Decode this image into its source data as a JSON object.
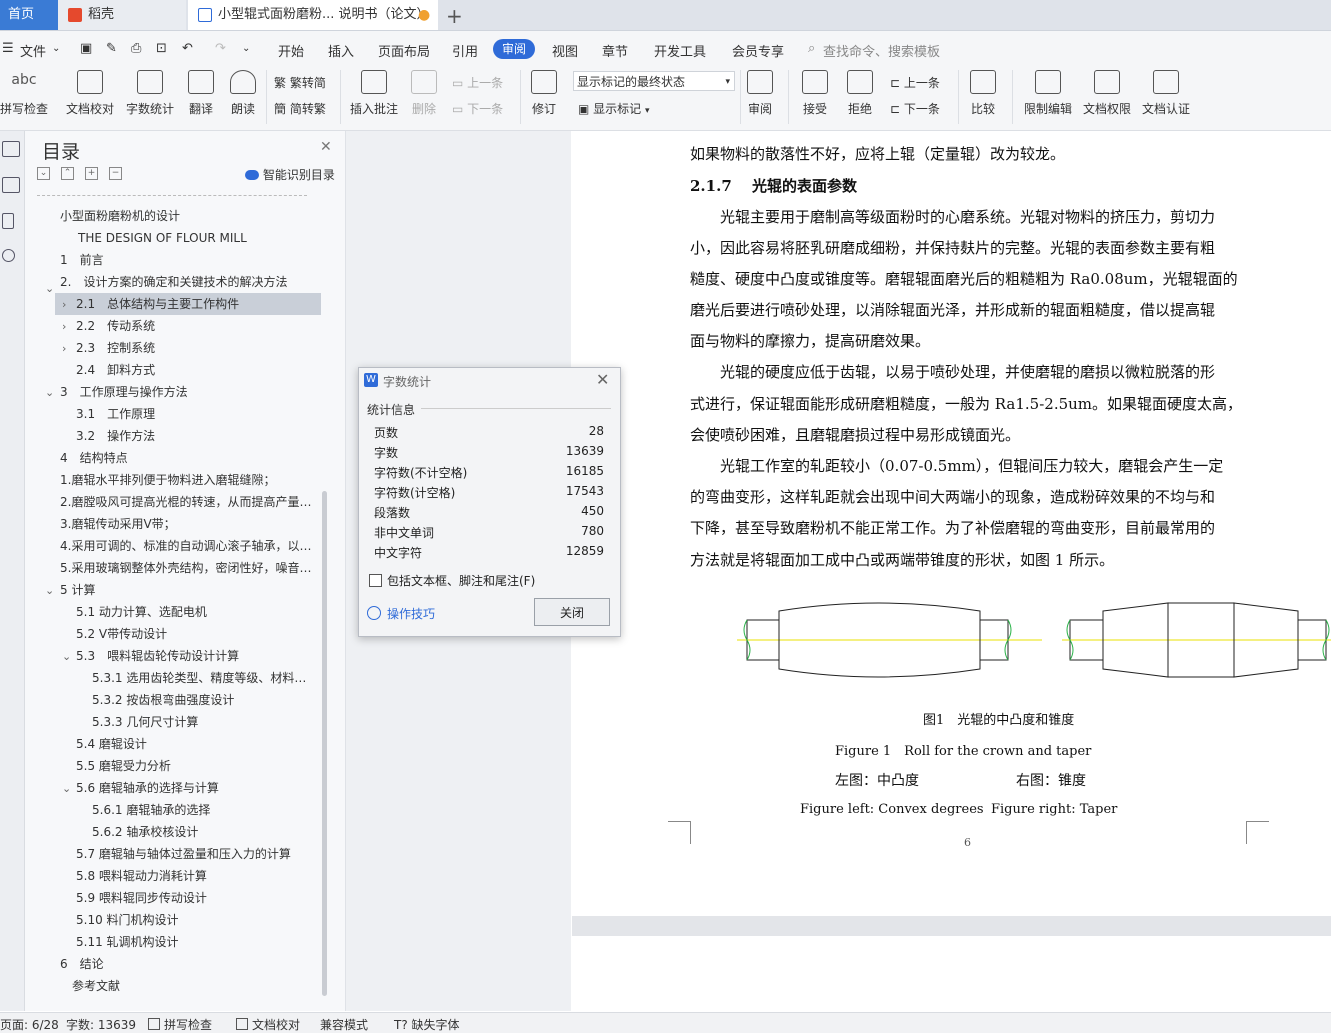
{
  "tabs": {
    "home": "首页",
    "daoke": "稻壳",
    "doc": "小型辊式面粉磨粉... 说明书（论文）"
  },
  "menu": {
    "file": "文件",
    "items": [
      "开始",
      "插入",
      "页面布局",
      "引用",
      "审阅",
      "视图",
      "章节",
      "开发工具",
      "会员专享"
    ],
    "search_placeholder": "查找命令、搜索模板"
  },
  "ribbon": {
    "spellcheck": "拼写检查",
    "doc_proof": "文档校对",
    "word_count": "字数统计",
    "translate": "翻译",
    "read_aloud": "朗读",
    "trad": "繁转简",
    "simp": "简转繁",
    "insert_comment": "插入批注",
    "delete": "删除",
    "prev": "上一条",
    "next": "下一条",
    "track": "修订",
    "markup_state": "显示标记的最终状态",
    "show_markup": "显示标记",
    "review": "审阅",
    "accept": "接受",
    "reject": "拒绝",
    "prev2": "上一条",
    "next2": "下一条",
    "compare": "比较",
    "restrict": "限制编辑",
    "doc_perm": "文档权限",
    "doc_cert": "文档认证"
  },
  "toc": {
    "title": "目录",
    "smart": "智能识别目录",
    "items": [
      "小型面粉磨粉机的设计",
      "THE DESIGN OF FLOUR MILL",
      "1　前言",
      "2.　设计方案的确定和关键技术的解决方法",
      "2.1　总体结构与主要工作构件",
      "2.2　传动系统",
      "2.3　控制系统",
      "2.4　卸料方式",
      "3　工作原理与操作方法",
      "3.1　工作原理",
      "3.2　操作方法",
      "4　结构特点",
      "1.磨辊水平排列便于物料进入磨辊缝隙；",
      "2.磨膛吸风可提高光棍的转速，从而提高产量…",
      "3.磨辊传动采用V带；",
      "4.采用可调的、标准的自动调心滚子轴承，以…",
      "5.采用玻璃钢整体外壳结构，密闭性好，噪音…",
      "5 计算",
      "5.1 动力计算、选配电机",
      "5.2 V带传动设计",
      "5.3　喂料辊齿轮传动设计计算",
      "5.3.1 选用齿轮类型、精度等级、材料…",
      "5.3.2 按齿根弯曲强度设计",
      "5.3.3 几何尺寸计算",
      "5.4 磨辊设计",
      "5.5 磨辊受力分析",
      "5.6 磨辊轴承的选择与计算",
      "5.6.1 磨辊轴承的选择",
      "5.6.2 轴承校核设计",
      "5.7 磨辊轴与轴体过盈量和压入力的计算",
      "5.8 喂料辊动力消耗计算",
      "5.9 喂料辊同步传动设计",
      "5.10 料门机构设计",
      "5.11 轧调机构设计",
      "6　结论",
      "参考文献"
    ]
  },
  "doc": {
    "p1": "如果物料的散落性不好，应将上辊（定量辊）改为较龙。",
    "heading": "2.1.7　 光辊的表面参数",
    "p2": [
      "　　光辊主要用于磨制高等级面粉时的心磨系统。光辊对物料的挤压力，剪切力",
      "小，因此容易将胚乳研磨成细粉，并保持麸片的完整。光辊的表面参数主要有粗",
      "糙度、硬度中凸度或锥度等。磨辊辊面磨光后的粗糙粗为 Ra0.08um，光辊辊面的",
      "磨光后要进行喷砂处理，以消除辊面光泽，并形成新的辊面粗糙度，借以提高辊",
      "面与物料的摩擦力，提高研磨效果。"
    ],
    "p3": [
      "　　光辊的硬度应低于齿辊，以易于喷砂处理，并使磨辊的磨损以微粒脱落的形",
      "式进行，保证辊面能形成研磨粗糙度，一般为 Ra1.5-2.5um。如果辊面硬度太高，",
      "会使喷砂困难，且磨辊磨损过程中易形成镜面光。"
    ],
    "p4": [
      "　　光辊工作室的轧距较小（0.07-0.5mm），但辊间压力较大，磨辊会产生一定",
      "的弯曲变形，这样轧距就会出现中间大两端小的现象，造成粉碎效果的不均与和",
      "下降，甚至导致磨粉机不能正常工作。为了补偿磨辊的弯曲变形，目前最常用的",
      "方法就是将辊面加工成中凸或两端带锥度的形状，如图 1 所示。"
    ],
    "fig_cn": "图1　光辊的中凸度和锥度",
    "fig_en": "Figure 1　Roll for the crown and taper",
    "fig_left_cn": "左图：中凸度",
    "fig_right_cn": "右图：锥度",
    "fig_left_en": "Figure left: Convex degrees",
    "fig_right_en": "Figure right: Taper",
    "page_num": "6"
  },
  "dialog": {
    "title": "字数统计",
    "section": "统计信息",
    "stats": [
      {
        "label": "页数",
        "value": "28"
      },
      {
        "label": "字数",
        "value": "13639"
      },
      {
        "label": "字符数(不计空格)",
        "value": "16185"
      },
      {
        "label": "字符数(计空格)",
        "value": "17543"
      },
      {
        "label": "段落数",
        "value": "450"
      },
      {
        "label": "非中文单词",
        "value": "780"
      },
      {
        "label": "中文字符",
        "value": "12859"
      }
    ],
    "include_label": "包括文本框、脚注和尾注(F)",
    "tips": "操作技巧",
    "close": "关闭"
  },
  "status": {
    "page": "页面: 6/28",
    "words": "字数: 13639",
    "spell": "拼写检查",
    "proof": "文档校对",
    "compat": "兼容模式",
    "missing_font": "缺失字体"
  },
  "colors": {
    "accent": "#2f6bd8",
    "figure_axis": "#e8e000",
    "figure_break": "#2bb34a"
  }
}
